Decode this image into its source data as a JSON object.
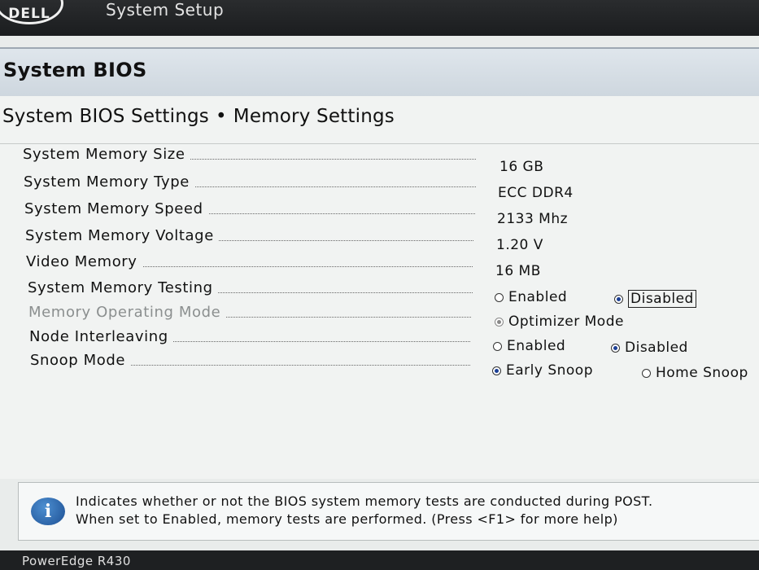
{
  "window": {
    "logo_text": "DELL",
    "app_title": "System Setup"
  },
  "section": {
    "title": "System BIOS"
  },
  "breadcrumb": {
    "parent": "System BIOS Settings",
    "separator": "•",
    "current": "Memory Settings"
  },
  "settings": {
    "memory_size": {
      "label": "System Memory Size",
      "value": "16 GB"
    },
    "memory_type": {
      "label": "System Memory Type",
      "value": "ECC DDR4"
    },
    "memory_speed": {
      "label": "System Memory Speed",
      "value": "2133 Mhz"
    },
    "memory_voltage": {
      "label": "System Memory Voltage",
      "value": "1.20 V"
    },
    "video_memory": {
      "label": "Video Memory",
      "value": "16 MB"
    },
    "memory_testing": {
      "label": "System Memory Testing",
      "options": [
        "Enabled",
        "Disabled"
      ],
      "selected": "Disabled"
    },
    "operating_mode": {
      "label": "Memory Operating Mode",
      "options": [
        "Optimizer Mode"
      ],
      "selected": "Optimizer Mode",
      "disabled": true
    },
    "node_interleaving": {
      "label": "Node Interleaving",
      "options": [
        "Enabled",
        "Disabled"
      ],
      "selected": "Disabled"
    },
    "snoop_mode": {
      "label": "Snoop Mode",
      "options": [
        "Early Snoop",
        "Home Snoop"
      ],
      "selected": "Early Snoop"
    }
  },
  "help": {
    "icon": "info-icon",
    "line1": "Indicates whether or not the BIOS system memory tests are conducted during POST.",
    "line2": "When set to Enabled, memory tests are performed. (Press <F1> for more help)"
  },
  "footer": {
    "model": "PowerEdge R430"
  },
  "colors": {
    "topbar": "#1b1d1f",
    "header": "#cdd6de",
    "radio_selected": "#1b3f95",
    "info_icon": "#1c4f93"
  }
}
